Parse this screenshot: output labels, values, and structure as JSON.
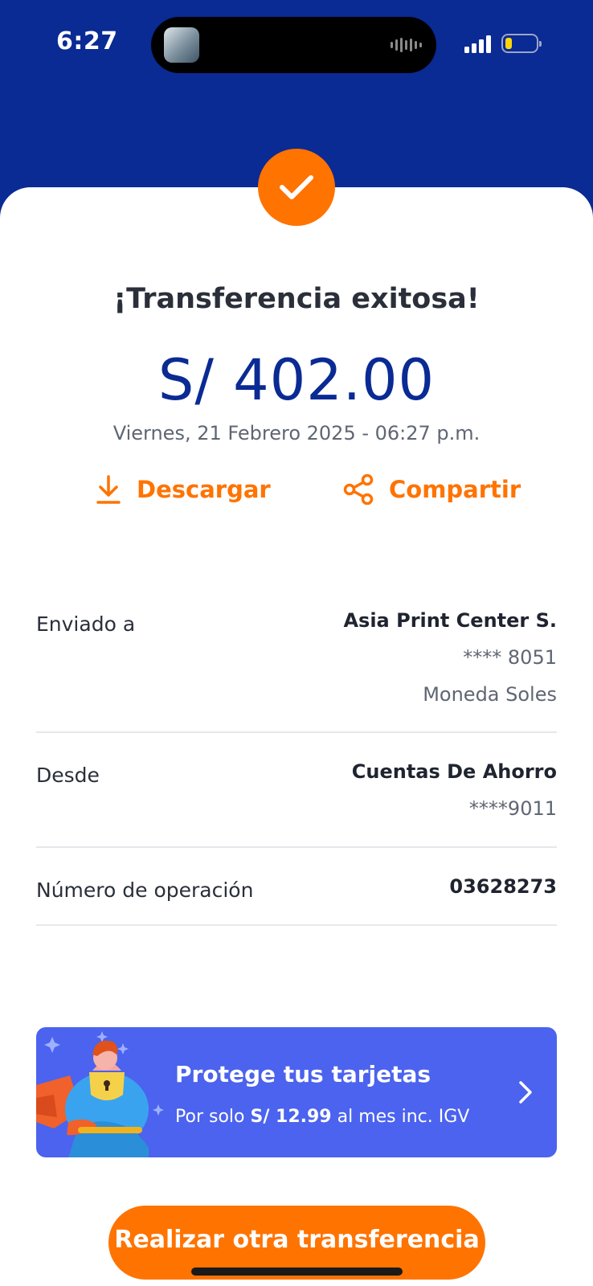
{
  "status": {
    "time": "6:27"
  },
  "receipt": {
    "title": "¡Transferencia exitosa!",
    "amount": "S/ 402.00",
    "datetime": "Viernes, 21 Febrero 2025 - 06:27 p.m."
  },
  "actions": {
    "download_label": "Descargar",
    "share_label": "Compartir"
  },
  "details": {
    "sent_to": {
      "label": "Enviado a",
      "name": "Asia Print Center S.",
      "account": "**** 8051",
      "currency": "Moneda Soles"
    },
    "from": {
      "label": "Desde",
      "name": "Cuentas De Ahorro",
      "account": "****9011"
    },
    "operation": {
      "label": "Número de operación",
      "value": "03628273"
    }
  },
  "promo": {
    "title": "Protege tus tarjetas",
    "subtitle_prefix": "Por solo ",
    "price": "S/ 12.99",
    "subtitle_suffix": " al mes inc. IGV"
  },
  "cta": {
    "label": "Realizar otra transferencia"
  },
  "icons": [
    "check-icon",
    "download-icon",
    "share-icon",
    "chevron-right-icon",
    "superhero-illustration"
  ],
  "colors": {
    "brand_blue": "#0a2a94",
    "accent_orange": "#ff7300",
    "promo_blue": "#4b63ee"
  }
}
